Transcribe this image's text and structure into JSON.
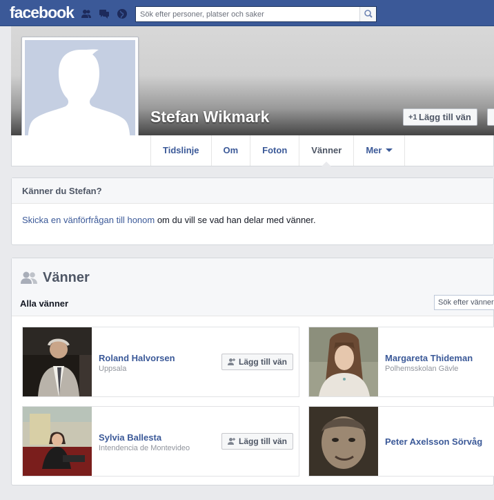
{
  "topbar": {
    "logo": "facebook",
    "search_placeholder": "Sök efter personer, platser och saker",
    "icons": [
      "friend-requests-icon",
      "messages-icon",
      "notifications-icon",
      "search-icon"
    ]
  },
  "profile": {
    "name": "Stefan Wikmark",
    "add_friend_label": "Lägg till vän"
  },
  "nav": {
    "tabs": [
      {
        "label": "Tidslinje"
      },
      {
        "label": "Om"
      },
      {
        "label": "Foton"
      },
      {
        "label": "Vänner"
      },
      {
        "label": "Mer"
      }
    ],
    "active_tab": "Vänner"
  },
  "know": {
    "title": "Känner du Stefan?",
    "link_text": "Skicka en vänförfrågan till honom",
    "rest_text": " om du vill se vad han delar med vänner."
  },
  "friends": {
    "title": "Vänner",
    "subtitle": "Alla vänner",
    "search_placeholder": "Sök efter vänner",
    "items": [
      {
        "name": "Roland Halvorsen",
        "subtitle": "Uppsala",
        "button": "Lägg till vän"
      },
      {
        "name": "Margareta Thideman",
        "subtitle": "Polhemsskolan Gävle"
      },
      {
        "name": "Sylvia Ballesta",
        "subtitle": "Intendencia de Montevideo",
        "button": "Lägg till vän"
      },
      {
        "name": "Peter Axelsson Sörvåg",
        "subtitle": ""
      }
    ]
  },
  "colors": {
    "brand": "#3b5998",
    "background": "#e9eaed",
    "link": "#3b5998"
  }
}
